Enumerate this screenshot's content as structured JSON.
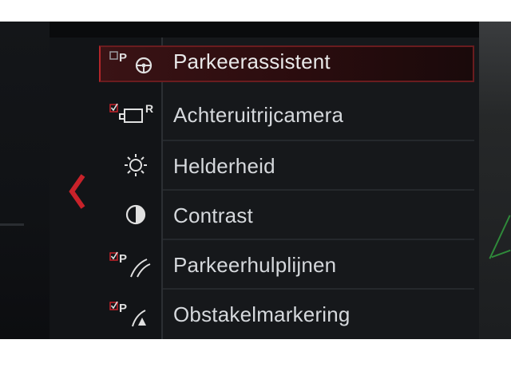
{
  "menu": {
    "items": [
      {
        "label": "Parkeerassistent",
        "icon": "park-steering-icon",
        "checkbox": false,
        "selected": true
      },
      {
        "label": "Achteruitrijcamera",
        "icon": "rear-camera-icon",
        "checkbox": true,
        "selected": false
      },
      {
        "label": "Helderheid",
        "icon": "brightness-icon",
        "checkbox": null,
        "selected": false
      },
      {
        "label": "Contrast",
        "icon": "contrast-icon",
        "checkbox": null,
        "selected": false
      },
      {
        "label": "Parkeerhulplijnen",
        "icon": "parking-guide-lines-icon",
        "checkbox": true,
        "selected": false
      },
      {
        "label": "Obstakelmarkering",
        "icon": "obstacle-marking-icon",
        "checkbox": true,
        "selected": false
      }
    ]
  },
  "icon_glyphs": {
    "p": "P",
    "r": "R"
  },
  "colors": {
    "accent_red": "#c8222a",
    "text": "#d5d8dc",
    "panel_bg": "#16181b"
  }
}
